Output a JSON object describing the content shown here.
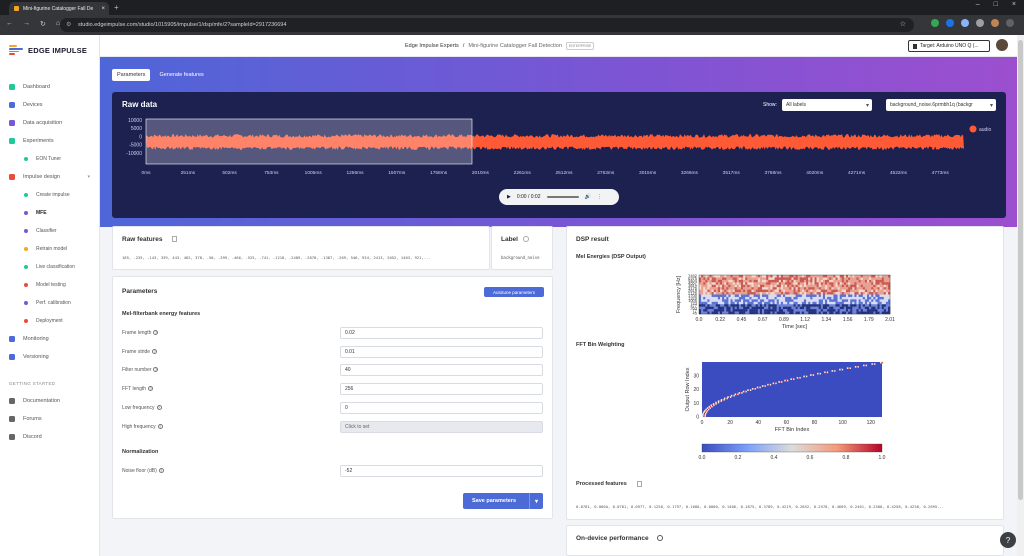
{
  "browser": {
    "tab_title": "Mini-figurine Catalogger Fall De",
    "url": "studio.edgeimpulse.com/studio/1015905/impulse/1/dsp/mfe/2?sampleId=2917236694"
  },
  "brand": {
    "name": "EDGE IMPULSE"
  },
  "sidebar": {
    "items": [
      {
        "label": "Dashboard",
        "icon": "dashboard-icon"
      },
      {
        "label": "Devices",
        "icon": "devices-icon"
      },
      {
        "label": "Data acquisition",
        "icon": "database-icon"
      },
      {
        "label": "Experiments",
        "icon": "experiments-icon"
      },
      {
        "label": "EON Tuner",
        "icon": "tuner-icon"
      },
      {
        "label": "Impulse design",
        "icon": "impulse-icon"
      },
      {
        "label": "Create impulse",
        "icon": "dot-icon"
      },
      {
        "label": "MFE",
        "icon": "dot-icon"
      },
      {
        "label": "Classifier",
        "icon": "dot-icon"
      },
      {
        "label": "Retrain model",
        "icon": "retrain-icon"
      },
      {
        "label": "Live classification",
        "icon": "live-icon"
      },
      {
        "label": "Model testing",
        "icon": "testing-icon"
      },
      {
        "label": "Perf. calibration",
        "icon": "calibration-icon"
      },
      {
        "label": "Deployment",
        "icon": "deploy-icon"
      },
      {
        "label": "Monitoring",
        "icon": "monitoring-icon"
      },
      {
        "label": "Versioning",
        "icon": "versioning-icon"
      }
    ],
    "getting_started": "GETTING STARTED",
    "help_items": [
      {
        "label": "Documentation",
        "icon": "docs-icon"
      },
      {
        "label": "Forums",
        "icon": "forums-icon"
      },
      {
        "label": "Discord",
        "icon": "discord-icon"
      }
    ]
  },
  "header": {
    "project_owner": "Edge Impulse Experts",
    "separator": "/",
    "project_name": "Mini-figurine Catalogger Fall Detection",
    "badge": "ENTERPRISE",
    "target": "Target: Arduino UNO Q (..."
  },
  "tabs": {
    "parameters": "Parameters",
    "generate": "Generate features"
  },
  "raw_data": {
    "title": "Raw data",
    "show_label": "Show:",
    "show_value": "All labels",
    "sample_value": "background_noise.6prmbh1q (backgr",
    "legend": "audio",
    "y_ticks": [
      "10000",
      "5000",
      "0",
      "-5000",
      "-10000"
    ],
    "x_ticks": [
      "0ms",
      "251ms",
      "502ms",
      "753ms",
      "1005ms",
      "1256ms",
      "1507ms",
      "1758ms",
      "2010ms",
      "2261ms",
      "2512ms",
      "2763ms",
      "3015ms",
      "3266ms",
      "3517ms",
      "3768ms",
      "4020ms",
      "4271ms",
      "4522ms",
      "4773ms"
    ],
    "audio_time": "0:00 / 0:02",
    "wave_color": "#ff5a36"
  },
  "raw_features": {
    "title": "Raw features",
    "values": "185, -235, -143, 339, 443, 462, 378, -50, -399, -466, -525, -741, -1218, -2489, -2878, -1387, -269, 546, 934, 2413, 2052, 1403, 921,..."
  },
  "label": {
    "title": "Label",
    "value": "background_noise"
  },
  "parameters": {
    "title": "Parameters",
    "autotune": "Autotune parameters",
    "section1": "Mel-filterbank energy features",
    "fields": [
      {
        "label": "Frame length",
        "value": "0.02"
      },
      {
        "label": "Frame stride",
        "value": "0.01"
      },
      {
        "label": "Filter number",
        "value": "40"
      },
      {
        "label": "FFT length",
        "value": "256"
      },
      {
        "label": "Low frequency",
        "value": "0"
      },
      {
        "label": "High frequency",
        "value": "Click to set"
      }
    ],
    "section2": "Normalization",
    "noise_label": "Noise floor (dB)",
    "noise_value": "-52",
    "save": "Save parameters"
  },
  "dsp": {
    "title": "DSP result",
    "mel_title": "Mel Energies (DSP Output)",
    "mel_ylabel": "Frequency [Hz]",
    "mel_xlabel": "Time [sec]",
    "mel_yticks": [
      "7492",
      "6376",
      "5404",
      "4557",
      "3819",
      "3176",
      "2615",
      "2126",
      "1700",
      "1329",
      "1005",
      "723",
      "477",
      "263",
      "77",
      "45"
    ],
    "mel_xticks": [
      "0.0",
      "0.22",
      "0.45",
      "0.67",
      "0.89",
      "1.12",
      "1.34",
      "1.56",
      "1.79",
      "2.01"
    ],
    "fft_title": "FFT Bin Weighting",
    "fft_ylabel": "Output Row Index",
    "fft_xlabel": "FFT Bin Index",
    "fft_yticks": [
      "0",
      "10",
      "20",
      "30"
    ],
    "fft_xticks": [
      "0",
      "20",
      "40",
      "60",
      "80",
      "100",
      "120"
    ],
    "cbar_ticks": [
      "0.0",
      "0.2",
      "0.4",
      "0.6",
      "0.8",
      "1.0"
    ],
    "processed_title": "Processed features",
    "processed_values": "0.0781, 0.066A, 0.0781, 0.0977, 0.1250, 0.1797, 0.1680, 0.0000, 0.1406, 0.1875, 0.3789, 0.4219, 0.2852, 0.2578, 0.4609, 0.2461, 0.2500, 0.4258, 0.4258, 0.2695...",
    "ondevice_title": "On-device performance"
  },
  "colors": {
    "accent": "#4c6bd6",
    "wave": "#ff5a36",
    "panel": "#1d2150"
  }
}
